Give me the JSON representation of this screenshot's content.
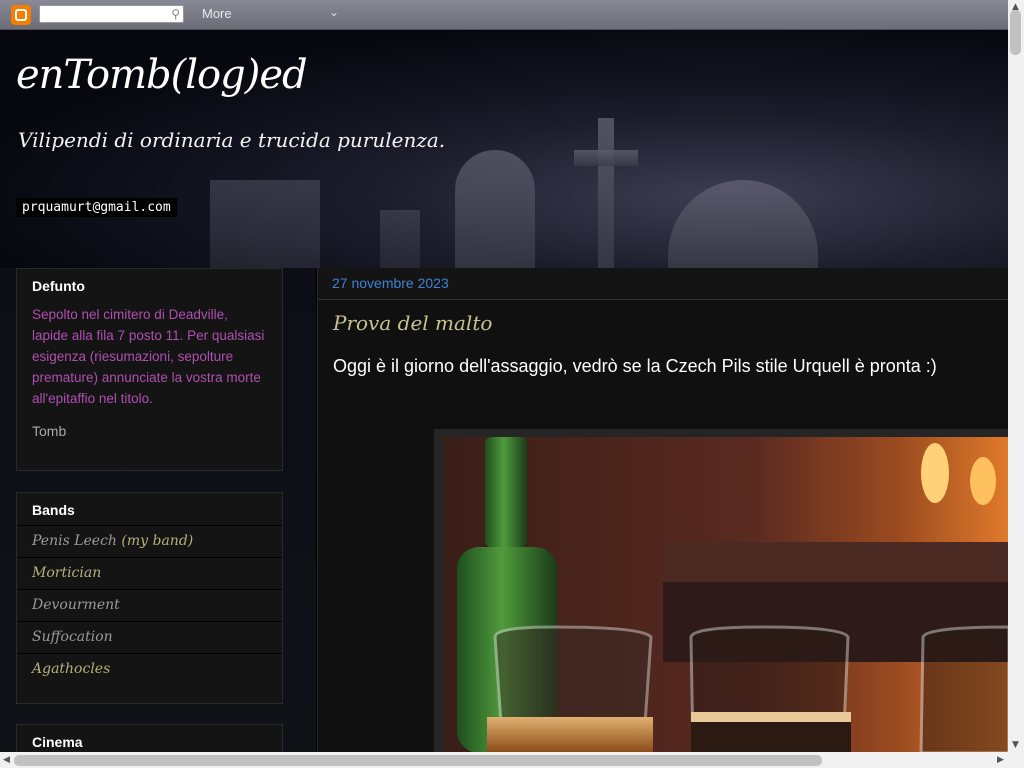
{
  "navbar": {
    "more_label": "More",
    "logo_icon": "blogger-logo-icon",
    "search_icon": "search-icon"
  },
  "header": {
    "title": "enTomb(log)ed",
    "description": "Vilipendi di ordinaria e trucida purulenza.",
    "email": "prquamurt@gmail.com"
  },
  "sidebar": {
    "defunto": {
      "title": "Defunto",
      "text": "Sepolto nel cimitero di Deadville, lapide alla fila 7 posto 11. Per qualsiasi esigenza (riesumazioni, sepolture premature) annunciate la vostra morte all'epitaffio nel titolo.",
      "signature": "Tomb"
    },
    "bands": {
      "title": "Bands",
      "items": [
        {
          "name": "Penis Leech",
          "note": "(my band)"
        },
        {
          "name": "Mortician"
        },
        {
          "name": "Devourment"
        },
        {
          "name": "Suffocation"
        },
        {
          "name": "Agathocles"
        }
      ]
    },
    "cinema": {
      "title": "Cinema"
    }
  },
  "post": {
    "date": "27 novembre 2023",
    "title": "Prova del malto",
    "body": "Oggi è il giorno dell'assaggio, vedrò se la Czech Pils stile Urquell è pronta :)"
  },
  "colors": {
    "date": "#3d83d5",
    "post_title": "#c7c28d",
    "sidebar_text": "#b04fb0",
    "link_olive": "#b6b07a"
  }
}
